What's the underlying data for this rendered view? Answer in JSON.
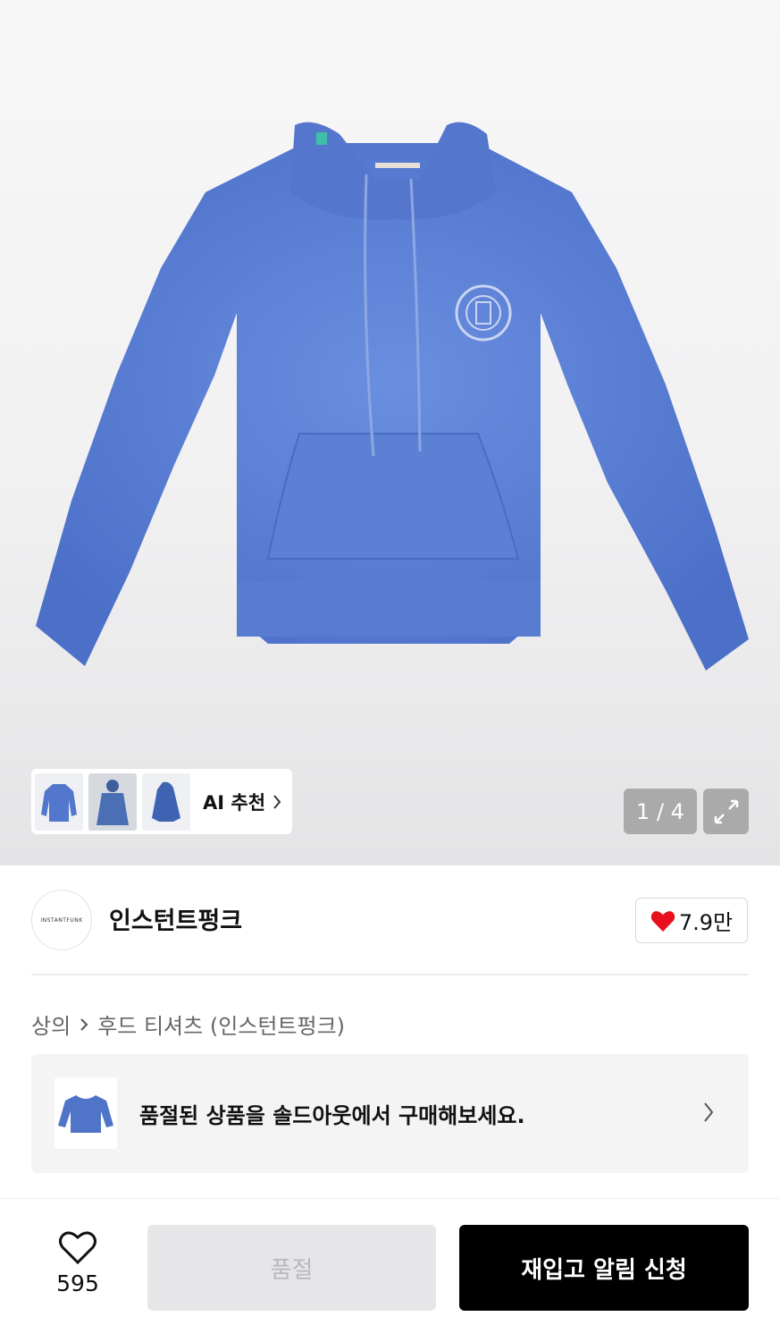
{
  "hero": {
    "colors": {
      "hoodie": "#5a7fd4",
      "background": "#f2f2f3"
    },
    "thumbnails": [
      {
        "icon": "hoodie-front-thumbnail"
      },
      {
        "icon": "hoodie-model-thumbnail"
      },
      {
        "icon": "hoodie-side-thumbnail"
      }
    ],
    "ai_label": "AI 추천",
    "counter": "1 / 4"
  },
  "brand": {
    "logo_text": "INSTANTFUNK",
    "name": "인스턴트펑크",
    "like_count": "7.9만",
    "like_color": "#e8101c"
  },
  "breadcrumb": {
    "category": "상의",
    "subcategory": "후드 티셔츠 (인스턴트펑크)"
  },
  "soldout_banner": {
    "text": "품절된 상품을 솔드아웃에서 구매해보세요."
  },
  "bottom_bar": {
    "wish_count": "595",
    "soldout_label": "품절",
    "restock_label": "재입고 알림 신청"
  }
}
